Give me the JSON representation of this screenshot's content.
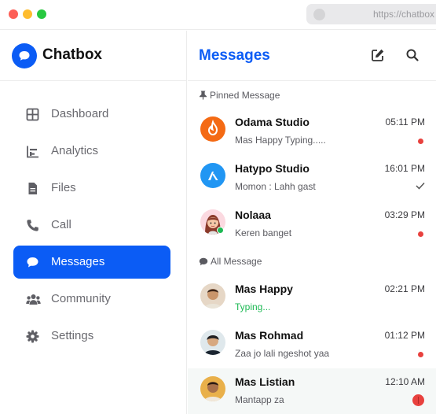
{
  "browser": {
    "url": "https://chatbox",
    "window_controls": [
      "close",
      "minimize",
      "maximize"
    ]
  },
  "app": {
    "name": "Chatbox",
    "logo_icon": "chat-bubble-icon",
    "accent_color": "#0b5cf5"
  },
  "sidebar": {
    "items": [
      {
        "label": "Dashboard",
        "icon": "dashboard-grid-icon",
        "active": false
      },
      {
        "label": "Analytics",
        "icon": "bar-chart-icon",
        "active": false
      },
      {
        "label": "Files",
        "icon": "file-icon",
        "active": false
      },
      {
        "label": "Call",
        "icon": "phone-icon",
        "active": false
      },
      {
        "label": "Messages",
        "icon": "chat-bubble-icon",
        "active": true
      },
      {
        "label": "Community",
        "icon": "people-icon",
        "active": false
      },
      {
        "label": "Settings",
        "icon": "gear-icon",
        "active": false
      }
    ]
  },
  "main": {
    "title": "Messages",
    "actions": [
      "compose-icon",
      "search-icon"
    ],
    "pinned_label": "Pinned Message",
    "all_label": "All Message",
    "pinned": [
      {
        "name": "Odama Studio",
        "preview": "Mas Happy Typing.....",
        "time": "05:11 PM",
        "status": "unread-dot",
        "avatar": "orange-flame-logo"
      },
      {
        "name": "Hatypo Studio",
        "preview": "Momon : Lahh gast",
        "time": "16:01 PM",
        "status": "read-check",
        "avatar": "blue-lambda-logo"
      },
      {
        "name": "Nolaaa",
        "preview": "Keren banget",
        "time": "03:29 PM",
        "status": "unread-dot",
        "avatar": "girl-avatar",
        "online": true
      }
    ],
    "all": [
      {
        "name": "Mas Happy",
        "preview": "Typing...",
        "time": "02:21 PM",
        "status": "none",
        "avatar": "man-photo-1",
        "typing": true
      },
      {
        "name": "Mas Rohmad",
        "preview": "Zaa jo lali ngeshot yaa",
        "time": "01:12 PM",
        "status": "unread-dot",
        "avatar": "man-photo-2"
      },
      {
        "name": "Mas Listian",
        "preview": "Mantapp za",
        "time": "12:10 AM",
        "status": "unread-badge",
        "avatar": "man-photo-3"
      }
    ]
  }
}
